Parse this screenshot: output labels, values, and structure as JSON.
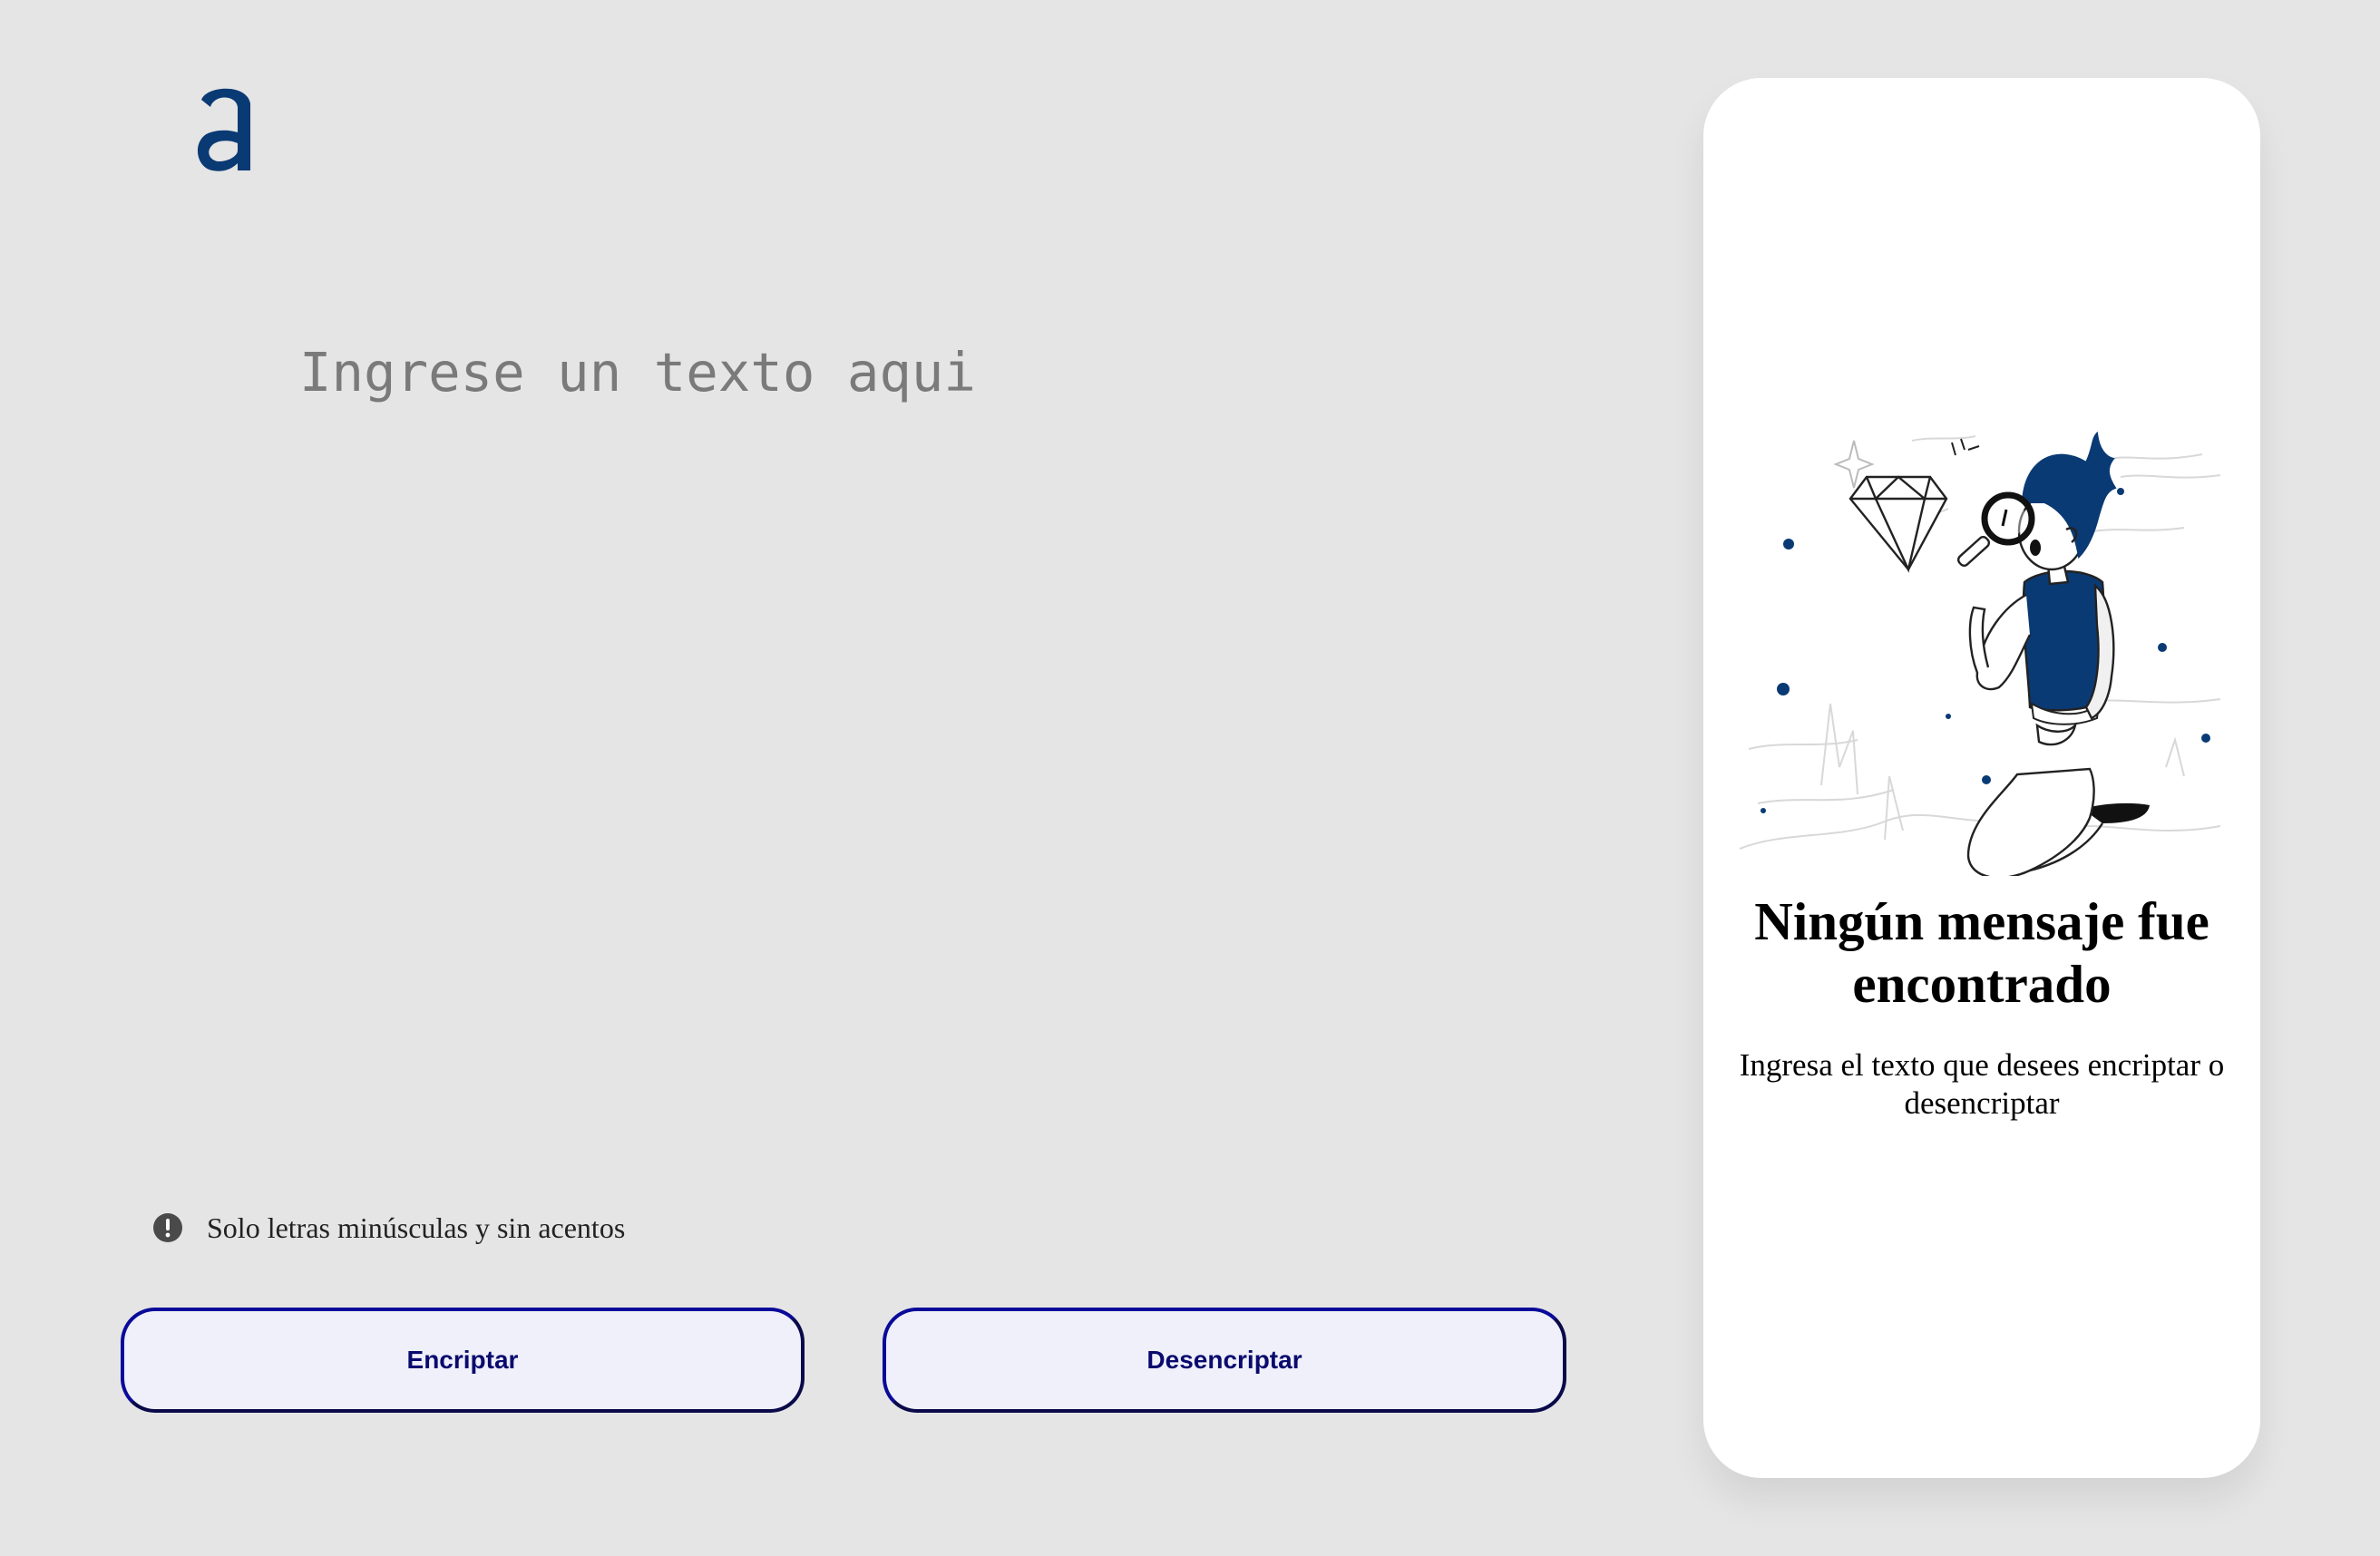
{
  "colors": {
    "brand": "#0a3a74",
    "background": "#e5e5e5",
    "button_border": "#0a0a9a",
    "button_bg": "#eff0f9",
    "button_text": "#0a0a6e"
  },
  "logo": {
    "icon": "alura-a-logo"
  },
  "input": {
    "placeholder": "Ingrese un texto aqui",
    "value": ""
  },
  "hint": {
    "icon": "exclamation-circle-icon",
    "text": "Solo letras minúsculas y sin acentos"
  },
  "buttons": {
    "encrypt_label": "Encriptar",
    "decrypt_label": "Desencriptar"
  },
  "result_panel": {
    "illustration": "person-magnifying-glass-diamond",
    "title": "Ningún mensaje fue encontrado",
    "subtitle": "Ingresa el texto que desees encriptar o desencriptar"
  }
}
